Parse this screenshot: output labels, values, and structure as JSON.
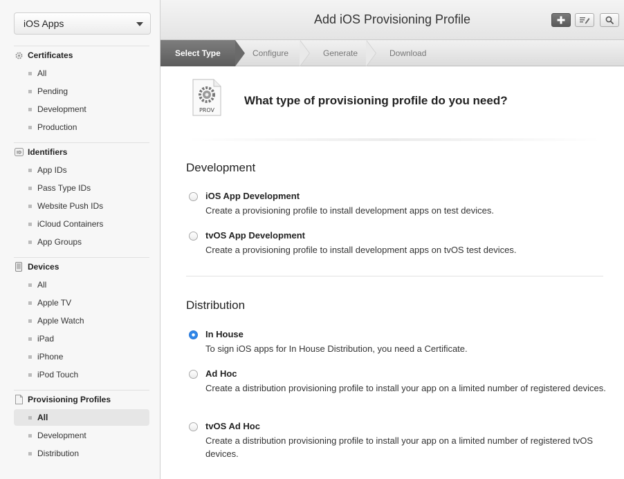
{
  "app_selector": {
    "label": "iOS Apps"
  },
  "sidebar": {
    "sections": [
      {
        "title": "Certificates",
        "icon": "certificate-gear-icon",
        "items": [
          "All",
          "Pending",
          "Development",
          "Production"
        ]
      },
      {
        "title": "Identifiers",
        "icon": "id-badge-icon",
        "items": [
          "App IDs",
          "Pass Type IDs",
          "Website Push IDs",
          "iCloud Containers",
          "App Groups"
        ]
      },
      {
        "title": "Devices",
        "icon": "device-icon",
        "items": [
          "All",
          "Apple TV",
          "Apple Watch",
          "iPad",
          "iPhone",
          "iPod Touch"
        ]
      },
      {
        "title": "Provisioning Profiles",
        "icon": "document-icon",
        "items": [
          "All",
          "Development",
          "Distribution"
        ],
        "active_item": "All"
      }
    ]
  },
  "header": {
    "title": "Add iOS Provisioning Profile",
    "buttons": [
      "add-icon",
      "edit-icon",
      "search-icon"
    ]
  },
  "steps": [
    "Select Type",
    "Configure",
    "Generate",
    "Download"
  ],
  "main": {
    "icon_label": "PROV",
    "question": "What type of provisioning profile do you need?",
    "groups": [
      {
        "title": "Development",
        "options": [
          {
            "title": "iOS App Development",
            "desc": "Create a provisioning profile to install development apps on test devices.",
            "selected": false
          },
          {
            "title": "tvOS App Development",
            "desc": "Create a provisioning profile to install development apps on tvOS test devices.",
            "selected": false
          }
        ]
      },
      {
        "title": "Distribution",
        "options": [
          {
            "title": "In House",
            "desc": "To sign iOS apps for In House Distribution, you need a Certificate.",
            "selected": true
          },
          {
            "title": "Ad Hoc",
            "desc": "Create a distribution provisioning profile to install your app on a limited number of registered devices.",
            "selected": false
          },
          {
            "title": "tvOS Ad Hoc",
            "desc": "Create a distribution provisioning profile to install your app on a limited number of registered tvOS devices.",
            "selected": false
          }
        ]
      }
    ]
  },
  "colors": {
    "accent": "#2f86e8",
    "step_active": "#6b6b6b"
  }
}
